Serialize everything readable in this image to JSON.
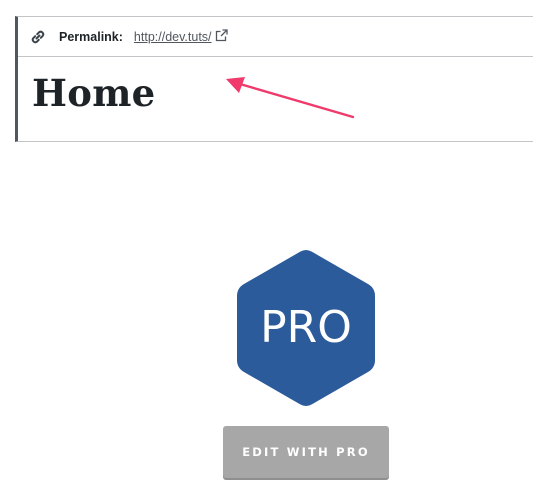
{
  "permalink": {
    "label": "Permalink:",
    "url": "http://dev.tuts/",
    "link_icon": "link-icon",
    "external_icon": "external-link-icon"
  },
  "page": {
    "title": "Home"
  },
  "logo": {
    "text": "PRO",
    "color": "#2b5b9b"
  },
  "button": {
    "label": "EDIT WITH PRO",
    "color": "#a7a7a7"
  },
  "annotation": {
    "arrow_color": "#ef3a6b"
  }
}
